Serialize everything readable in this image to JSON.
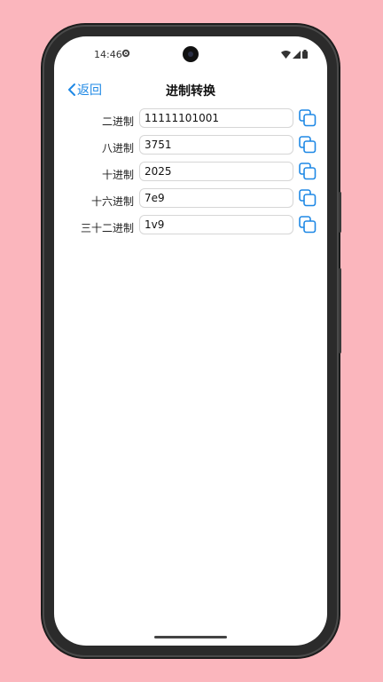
{
  "status_bar": {
    "time": "14:46",
    "icons": [
      "gear-icon",
      "wifi-icon",
      "signal-icon",
      "battery-icon"
    ]
  },
  "nav": {
    "back_label": "返回",
    "title": "进制转换"
  },
  "rows": [
    {
      "label": "二进制",
      "value": "11111101001"
    },
    {
      "label": "八进制",
      "value": "3751"
    },
    {
      "label": "十进制",
      "value": "2025"
    },
    {
      "label": "十六进制",
      "value": "7e9"
    },
    {
      "label": "三十二进制",
      "value": "1v9"
    }
  ],
  "colors": {
    "accent": "#1e88e5",
    "background": "#fbb6bd"
  }
}
